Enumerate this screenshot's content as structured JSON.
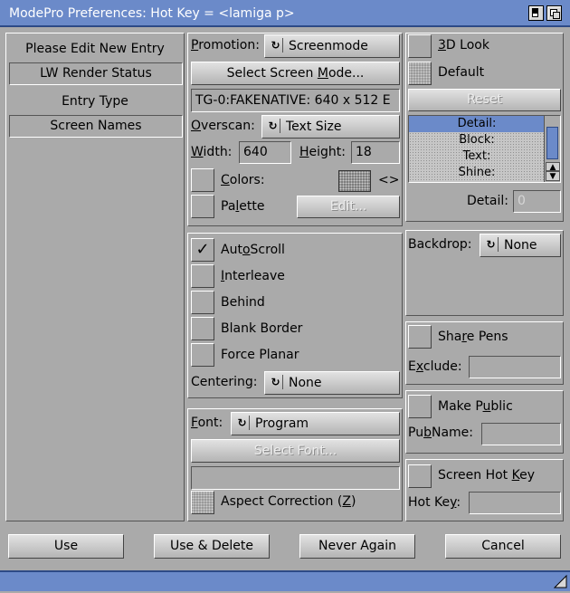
{
  "window": {
    "title": "ModePro Preferences: Hot Key = <lamiga p>"
  },
  "left_panel": {
    "edit_label": "Please Edit New Entry",
    "entry_value": "LW Render Status",
    "entry_type_label": "Entry Type",
    "entry_type_value": "Screen Names"
  },
  "screen_group": {
    "promotion_label": "Promotion:",
    "promotion_value": "Screenmode",
    "select_mode_button": "Select Screen Mode...",
    "mode_display": "TG-0:FAKENATIVE: 640 x  512 E",
    "overscan_label": "Overscan:",
    "overscan_value": "Text Size",
    "width_label": "Width:",
    "width_value": "640",
    "height_label": "Height:",
    "height_value": "18",
    "colors_label": "Colors:",
    "colors_arrows": "<>",
    "palette_label": "Palette",
    "edit_button": "Edit..."
  },
  "flags_group": {
    "autoscroll_label": "AutoScroll",
    "autoscroll_checked": true,
    "interleave_label": "Interleave",
    "behind_label": "Behind",
    "blank_border_label": "Blank Border",
    "force_planar_label": "Force Planar",
    "centering_label": "Centering:",
    "centering_value": "None"
  },
  "font_group": {
    "font_label": "Font:",
    "font_value": "Program",
    "select_font_button": "Select Font...",
    "font_display": "",
    "aspect_label": "Aspect Correction (Z)"
  },
  "look_group": {
    "look3d_label": "3D Look",
    "default_label": "Default",
    "reset_button": "Reset",
    "pen_list": [
      "Detail:",
      "Block:",
      "Text:",
      "Shine:"
    ],
    "detail_label": "Detail:",
    "detail_value": "0"
  },
  "backdrop_group": {
    "backdrop_label": "Backdrop:",
    "backdrop_value": "None"
  },
  "pens_group": {
    "share_pens_label": "Share Pens",
    "exclude_label": "Exclude:",
    "exclude_value": ""
  },
  "public_group": {
    "make_public_label": "Make Public",
    "pubname_label": "PubName:",
    "pubname_value": ""
  },
  "hotkey_group": {
    "screen_hotkey_label": "Screen Hot Key",
    "hotkey_label": "Hot Key:",
    "hotkey_value": ""
  },
  "footer": {
    "use_button": "Use",
    "use_delete_button": "Use & Delete",
    "never_again_button": "Never Again",
    "cancel_button": "Cancel"
  }
}
